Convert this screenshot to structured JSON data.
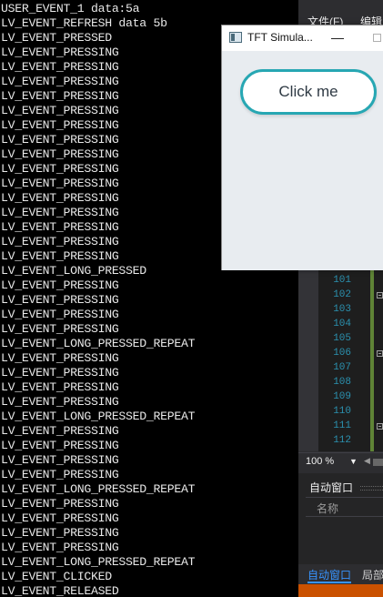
{
  "console": {
    "lines": [
      "USER_EVENT_1 data:5a",
      "LV_EVENT_REFRESH data 5b",
      "LV_EVENT_PRESSED",
      "LV_EVENT_PRESSING",
      "LV_EVENT_PRESSING",
      "LV_EVENT_PRESSING",
      "LV_EVENT_PRESSING",
      "LV_EVENT_PRESSING",
      "LV_EVENT_PRESSING",
      "LV_EVENT_PRESSING",
      "LV_EVENT_PRESSING",
      "LV_EVENT_PRESSING",
      "LV_EVENT_PRESSING",
      "LV_EVENT_PRESSING",
      "LV_EVENT_PRESSING",
      "LV_EVENT_PRESSING",
      "LV_EVENT_PRESSING",
      "LV_EVENT_PRESSING",
      "LV_EVENT_LONG_PRESSED",
      "LV_EVENT_PRESSING",
      "LV_EVENT_PRESSING",
      "LV_EVENT_PRESSING",
      "LV_EVENT_PRESSING",
      "LV_EVENT_LONG_PRESSED_REPEAT",
      "LV_EVENT_PRESSING",
      "LV_EVENT_PRESSING",
      "LV_EVENT_PRESSING",
      "LV_EVENT_PRESSING",
      "LV_EVENT_LONG_PRESSED_REPEAT",
      "LV_EVENT_PRESSING",
      "LV_EVENT_PRESSING",
      "LV_EVENT_PRESSING",
      "LV_EVENT_PRESSING",
      "LV_EVENT_LONG_PRESSED_REPEAT",
      "LV_EVENT_PRESSING",
      "LV_EVENT_PRESSING",
      "LV_EVENT_PRESSING",
      "LV_EVENT_PRESSING",
      "LV_EVENT_LONG_PRESSED_REPEAT",
      "LV_EVENT_CLICKED",
      "LV_EVENT_RELEASED"
    ]
  },
  "ide": {
    "menu": {
      "file": "文件(F)",
      "edit": "编辑"
    },
    "line_numbers": [
      "101",
      "102",
      "103",
      "104",
      "105",
      "106",
      "107",
      "108",
      "109",
      "110",
      "111",
      "112"
    ],
    "zoom": "100 %",
    "auto_window": {
      "title": "自动窗口",
      "column_name": "名称"
    },
    "bottom_tabs": {
      "auto": "自动窗口",
      "local": "局部"
    },
    "accent_color": "#ca5100"
  },
  "tft_window": {
    "title": "TFT Simula...",
    "minimize_glyph": "—",
    "button_label": "Click me",
    "button_border_color": "#27a7b3"
  }
}
